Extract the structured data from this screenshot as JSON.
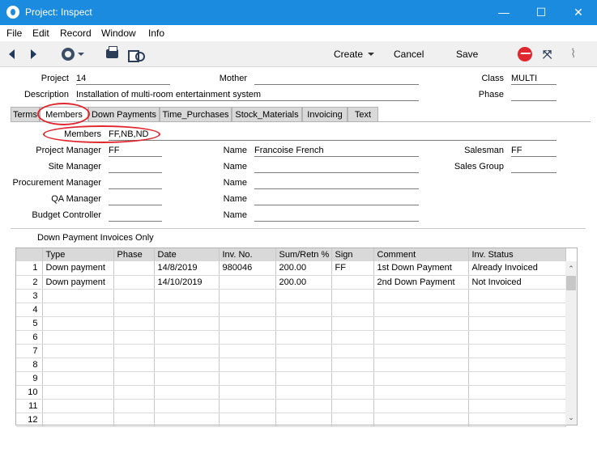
{
  "window": {
    "title": "Project: Inspect",
    "minimize_glyph": "—",
    "maximize_glyph": "☐",
    "close_glyph": "✕"
  },
  "menu": [
    "File",
    "Edit",
    "Record",
    "Window",
    "Info"
  ],
  "toolbar": {
    "create_label": "Create",
    "cancel_label": "Cancel",
    "save_label": "Save",
    "icons": [
      "prev-record-icon",
      "next-record-icon",
      "gear-icon",
      "print-icon",
      "find-icon",
      "activity-icon",
      "expand-icon",
      "attachment-icon"
    ]
  },
  "header": {
    "project_label": "Project",
    "project_value": "14",
    "mother_label": "Mother",
    "mother_value": "",
    "class_label": "Class",
    "class_value": "MULTI",
    "description_label": "Description",
    "description_value": "Installation of multi-room entertainment system",
    "phase_label": "Phase",
    "phase_value": ""
  },
  "tabs": [
    "Terms",
    "Members",
    "Down Payments",
    "Time_Purchases",
    "Stock_Materials",
    "Invoicing",
    "Text"
  ],
  "members": {
    "members_label": "Members",
    "members_value": "FF,NB,ND",
    "project_manager_label": "Project Manager",
    "project_manager_value": "FF",
    "site_manager_label": "Site Manager",
    "site_manager_value": "",
    "procurement_manager_label": "Procurement Manager",
    "procurement_manager_value": "",
    "qa_manager_label": "QA Manager",
    "qa_manager_value": "",
    "budget_controller_label": "Budget Controller",
    "budget_controller_value": "",
    "name_label": "Name",
    "name_values": [
      "Francoise French",
      "",
      "",
      "",
      ""
    ],
    "salesman_label": "Salesman",
    "salesman_value": "FF",
    "sales_group_label": "Sales Group",
    "sales_group_value": ""
  },
  "down_payments": {
    "section_label": "Down Payment Invoices Only",
    "columns": [
      "",
      "Type",
      "Phase",
      "Date",
      "Inv. No.",
      "Sum/Retn %",
      "Sign",
      "Comment",
      "Inv. Status"
    ],
    "rows": [
      [
        "1",
        "Down payment",
        "",
        "14/8/2019",
        "980046",
        "200.00",
        "FF",
        "1st Down Payment",
        "Already Invoiced"
      ],
      [
        "2",
        "Down payment",
        "",
        "14/10/2019",
        "",
        "200.00",
        "",
        "2nd Down Payment",
        "Not Invoiced"
      ],
      [
        "3",
        "",
        "",
        "",
        "",
        "",
        "",
        "",
        ""
      ],
      [
        "4",
        "",
        "",
        "",
        "",
        "",
        "",
        "",
        ""
      ],
      [
        "5",
        "",
        "",
        "",
        "",
        "",
        "",
        "",
        ""
      ],
      [
        "6",
        "",
        "",
        "",
        "",
        "",
        "",
        "",
        ""
      ],
      [
        "7",
        "",
        "",
        "",
        "",
        "",
        "",
        "",
        ""
      ],
      [
        "8",
        "",
        "",
        "",
        "",
        "",
        "",
        "",
        ""
      ],
      [
        "9",
        "",
        "",
        "",
        "",
        "",
        "",
        "",
        ""
      ],
      [
        "10",
        "",
        "",
        "",
        "",
        "",
        "",
        "",
        ""
      ],
      [
        "11",
        "",
        "",
        "",
        "",
        "",
        "",
        "",
        ""
      ],
      [
        "12",
        "",
        "",
        "",
        "",
        "",
        "",
        "",
        ""
      ]
    ]
  },
  "colors": {
    "titlebar": "#1b8be0",
    "highlight": "#e0262f",
    "tab_inactive": "#d9d9d9"
  }
}
